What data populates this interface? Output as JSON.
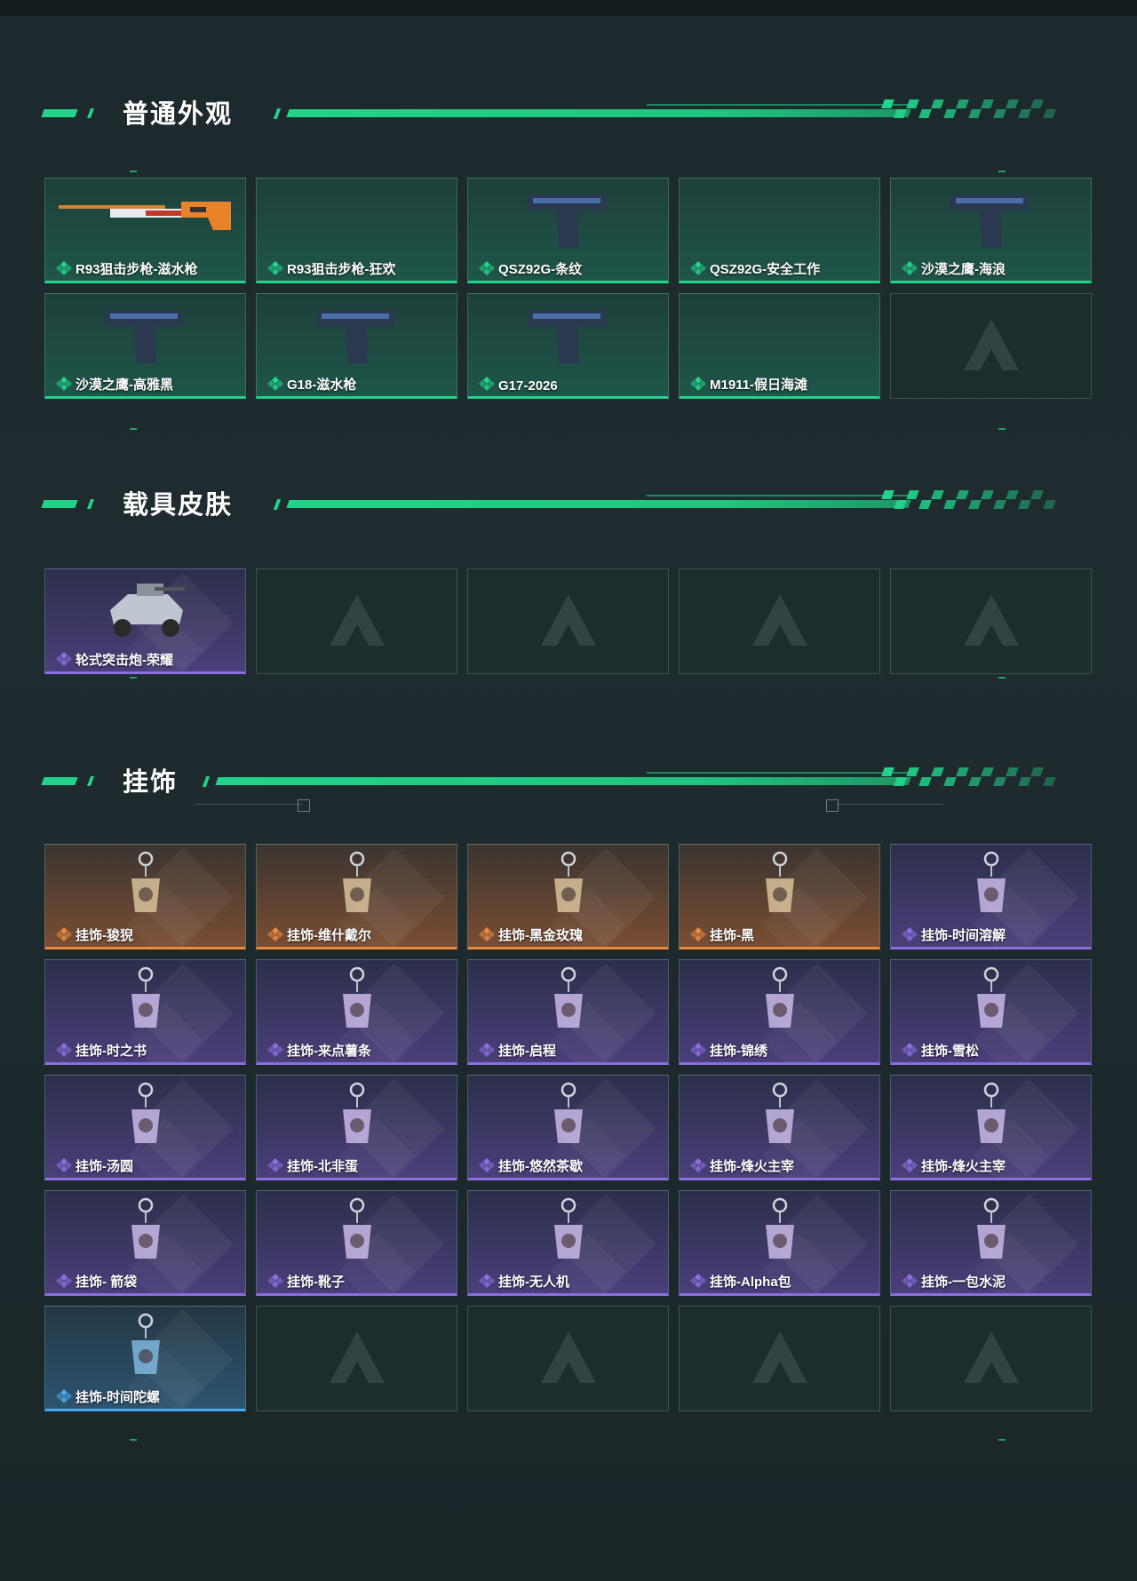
{
  "sections": {
    "s1": {
      "title": "普通外观"
    },
    "s2": {
      "title": "载具皮肤"
    },
    "s3": {
      "title": "挂饰"
    }
  },
  "colors": {
    "accent": "#22d48a",
    "rare_green": "#22d48a",
    "epic_purple": "#8b6fe0",
    "legend_orange": "#e88a40",
    "blue": "#4aa8e8"
  },
  "weapons": [
    {
      "label": "R93狙击步枪-滋水枪",
      "rarity": "green",
      "icon": "sniper-rifle-icon"
    },
    {
      "label": "R93狙击步枪-狂欢",
      "rarity": "green",
      "icon": ""
    },
    {
      "label": "QSZ92G-条纹",
      "rarity": "green",
      "icon": "pistol-icon"
    },
    {
      "label": "QSZ92G-安全工作",
      "rarity": "green",
      "icon": ""
    },
    {
      "label": "沙漠之鹰-海浪",
      "rarity": "green",
      "icon": "pistol-icon"
    },
    {
      "label": "沙漠之鹰-高雅黑",
      "rarity": "green",
      "icon": "pistol-icon"
    },
    {
      "label": "G18-滋水枪",
      "rarity": "green",
      "icon": "pistol-icon"
    },
    {
      "label": "G17-2026",
      "rarity": "green",
      "icon": "pistol-icon"
    },
    {
      "label": "M1911-假日海滩",
      "rarity": "green",
      "icon": ""
    }
  ],
  "vehicles": [
    {
      "label": "轮式突击炮-荣耀",
      "rarity": "purple",
      "icon": "vehicle-icon"
    }
  ],
  "charms": [
    {
      "label": "挂饰-狻猊",
      "rarity": "orange"
    },
    {
      "label": "挂饰-维什戴尔",
      "rarity": "orange"
    },
    {
      "label": "挂饰-黑金玫瑰",
      "rarity": "orange"
    },
    {
      "label": "挂饰-黑",
      "rarity": "orange"
    },
    {
      "label": "挂饰-时间溶解",
      "rarity": "purple"
    },
    {
      "label": "挂饰-时之书",
      "rarity": "purple"
    },
    {
      "label": "挂饰-来点薯条",
      "rarity": "purple"
    },
    {
      "label": "挂饰-启程",
      "rarity": "purple"
    },
    {
      "label": "挂饰-锦绣",
      "rarity": "purple"
    },
    {
      "label": "挂饰-雪松",
      "rarity": "purple"
    },
    {
      "label": "挂饰-汤圆",
      "rarity": "purple"
    },
    {
      "label": "挂饰-北非蛋",
      "rarity": "purple"
    },
    {
      "label": "挂饰-悠然茶歇",
      "rarity": "purple"
    },
    {
      "label": "挂饰-烽火主宰",
      "rarity": "purple"
    },
    {
      "label": "挂饰-烽火主宰",
      "rarity": "purple"
    },
    {
      "label": "挂饰- 箭袋",
      "rarity": "purple"
    },
    {
      "label": "挂饰-靴子",
      "rarity": "purple"
    },
    {
      "label": "挂饰-无人机",
      "rarity": "purple"
    },
    {
      "label": "挂饰-Alpha包",
      "rarity": "purple"
    },
    {
      "label": "挂饰-一包水泥",
      "rarity": "purple"
    },
    {
      "label": "挂饰-时间陀螺",
      "rarity": "blue"
    }
  ]
}
